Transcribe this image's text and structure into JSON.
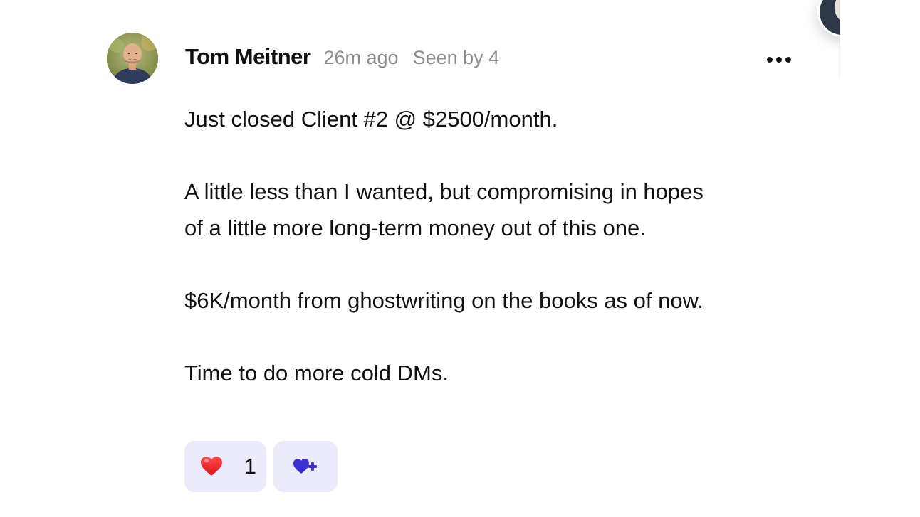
{
  "post": {
    "author": "Tom Meitner",
    "time_ago": "26m ago",
    "seen_by": "Seen by 4",
    "body": {
      "line1": "Just closed Client #2 @ $2500/month.",
      "line2a": "A little less than I wanted, but compromising in hopes",
      "line2b": "of a little more long-term money out of this one.",
      "line3": "$6K/month from ghostwriting on the books as of now.",
      "line4": "Time to do more cold DMs."
    },
    "reactions": {
      "heart_icon": "heart-emoji",
      "heart_count": "1",
      "add_icon": "add-reaction-icon"
    }
  },
  "colors": {
    "author": "#111111",
    "meta": "#8b8b8b",
    "reaction_bg": "#ecebfb",
    "accent": "#3a2fd1",
    "heart": "#e01b24"
  }
}
